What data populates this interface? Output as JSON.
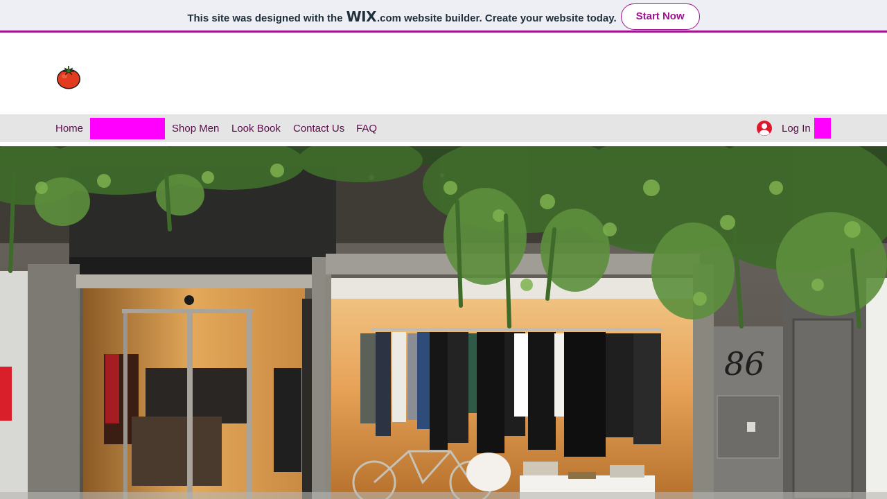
{
  "banner": {
    "text_before": "This site was designed with the",
    "wix_logo": "WIX",
    "text_after": ".com website builder. Create your website today.",
    "cta_label": "Start Now",
    "accent": "#a0138e"
  },
  "header": {
    "logo_icon": "tomato-icon"
  },
  "nav": {
    "items": [
      {
        "label": "Home"
      },
      {
        "label": ""
      },
      {
        "label": "Shop Men"
      },
      {
        "label": "Look Book"
      },
      {
        "label": "Contact Us"
      },
      {
        "label": "FAQ"
      }
    ],
    "login_label": "Log In",
    "login_icon": "user-avatar-icon",
    "highlight_color": "#ff00ff",
    "text_color": "#5a0c4a"
  },
  "hero": {
    "image": "storefront-photo",
    "sign_number": "86"
  }
}
